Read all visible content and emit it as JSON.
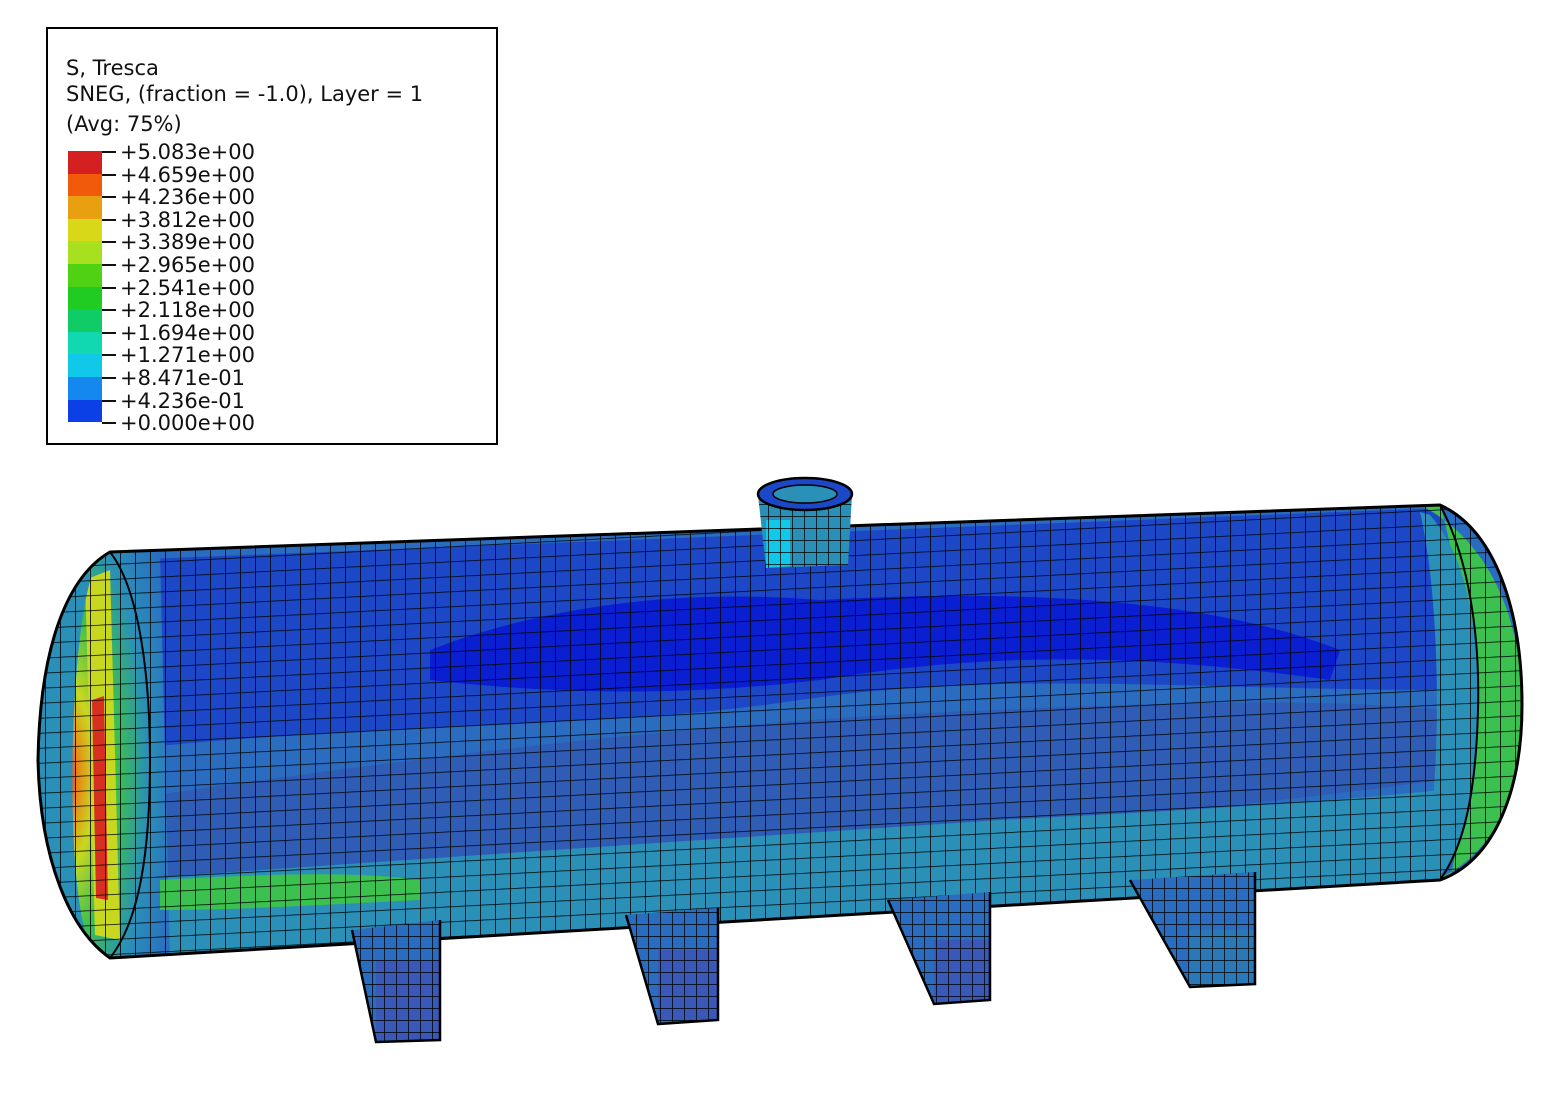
{
  "legend": {
    "title_lines": [
      "S, Tresca",
      "SNEG, (fraction = -1.0), Layer = 1",
      "(Avg: 75%)"
    ],
    "contour_values": [
      "+5.083e+00",
      "+4.659e+00",
      "+4.236e+00",
      "+3.812e+00",
      "+3.389e+00",
      "+2.965e+00",
      "+2.541e+00",
      "+2.118e+00",
      "+1.694e+00",
      "+1.271e+00",
      "+8.471e-01",
      "+4.236e-01",
      "+0.000e+00"
    ],
    "band_colors_top_to_bottom": [
      "#d42020",
      "#f05a0a",
      "#e8a010",
      "#d8d818",
      "#a6e01e",
      "#50d214",
      "#20cc22",
      "#10cc66",
      "#12d8b0",
      "#10c8e8",
      "#1488ee",
      "#0a40e6"
    ]
  },
  "model": {
    "stress_colors": {
      "low": "#0a1ed2",
      "low_mid": "#1c48c8",
      "mid": "#2a6cc0",
      "teal": "#2a90b8",
      "green": "#3cc050",
      "yellow": "#c8d820",
      "orange": "#e88a18",
      "red": "#d83020"
    }
  }
}
